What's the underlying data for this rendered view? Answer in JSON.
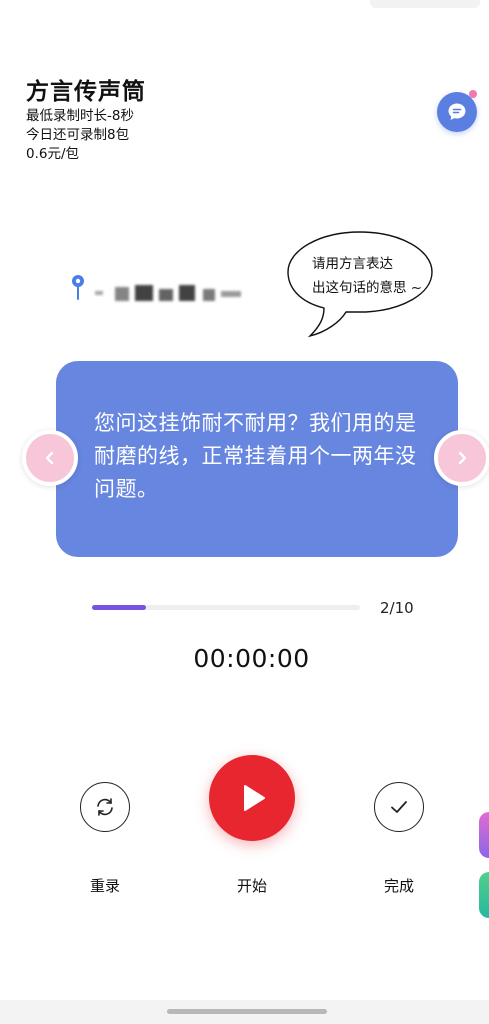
{
  "header": {
    "title": "方言传声筒",
    "min_duration": "最低录制时长-8秒",
    "remaining": "今日还可录制8包",
    "price": "0.6元/包"
  },
  "hint": {
    "line1": "请用方言表达",
    "line2": "出这句话的意思 ~"
  },
  "card": {
    "sentence": "您问这挂饰耐不耐用？我们用的是耐磨的线，正常挂着用个一两年没问题。",
    "color": "#6786e0"
  },
  "progress": {
    "current": 2,
    "total": 10,
    "label": "2/10",
    "fraction": 0.2
  },
  "timer": "00:00:00",
  "controls": {
    "rerecord_label": "重录",
    "start_label": "开始",
    "done_label": "完成"
  },
  "colors": {
    "accent": "#7a52e3",
    "start": "#e8262f",
    "arrow": "#f8c6d9"
  },
  "icons": {
    "chat": "chat-bubble-icon",
    "prev": "chevron-left-icon",
    "next": "chevron-right-icon",
    "rerecord": "refresh-icon",
    "start": "play-icon",
    "done": "check-icon",
    "location": "location-pin-icon"
  }
}
